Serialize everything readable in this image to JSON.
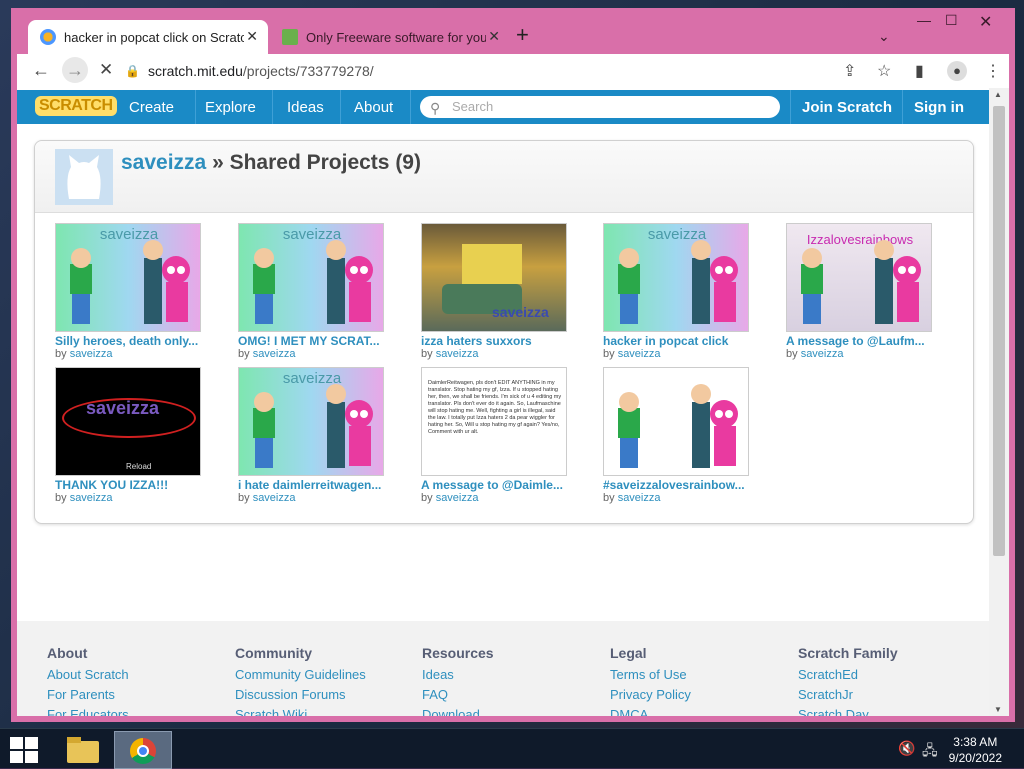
{
  "browser": {
    "tabs": [
      {
        "title": "hacker in popcat click on Scratch",
        "active": true
      },
      {
        "title": "Only Freeware software for your",
        "active": false
      }
    ],
    "new_tab": "+",
    "url_host": "scratch.mit.edu",
    "url_path": "/projects/733779278/"
  },
  "scratch_nav": {
    "logo": "SCRATCH",
    "links": [
      "Create",
      "Explore",
      "Ideas",
      "About"
    ],
    "search_placeholder": "Search",
    "join": "Join Scratch",
    "signin": "Sign in"
  },
  "profile": {
    "username": "saveizza",
    "heading_rest": " » Shared Projects (9)"
  },
  "projects": [
    {
      "title": "Silly heroes, death only...",
      "by": "by",
      "author": "saveizza",
      "thumb": "heroes"
    },
    {
      "title": "OMG! I MET MY SCRAT...",
      "by": "by",
      "author": "saveizza",
      "thumb": "heroes"
    },
    {
      "title": "izza haters suxxors",
      "by": "by",
      "author": "saveizza",
      "thumb": "game"
    },
    {
      "title": "hacker in popcat click",
      "by": "by",
      "author": "saveizza",
      "thumb": "heroes"
    },
    {
      "title": "A message to @Laufm...",
      "by": "by",
      "author": "saveizza",
      "thumb": "rainbows"
    },
    {
      "title": "THANK YOU IZZA!!!",
      "by": "by",
      "author": "saveizza",
      "thumb": "dark"
    },
    {
      "title": "i hate daimlerreitwagen...",
      "by": "by",
      "author": "saveizza",
      "thumb": "heroes"
    },
    {
      "title": "A message to @Daimle...",
      "by": "by",
      "author": "saveizza",
      "thumb": "text"
    },
    {
      "title": "#saveizzalovesrainbow...",
      "by": "by",
      "author": "saveizza",
      "thumb": "white"
    }
  ],
  "thumb_text": {
    "banner": "saveizza",
    "rainbows": "Izzalovesrainbows",
    "reload": "Reload",
    "message": "DaimlerReitwagen, pls don't EDIT ANYTHING in my translator. Stop hating my gf, Izza. If u stopped hating her, then, we shall be friends. I'm sick of u 4 editing my translator. Pls don't ever do it again. So, Laufmaschine will stop hating me. Well, fighting a girl is illegal, said the law. I totally put Izza haters 2 da pear wiggler for hating her. So, Will u stop hating my gf again? Yes/no, Comment with ur alt."
  },
  "footer": {
    "columns": [
      {
        "heading": "About",
        "links": [
          "About Scratch",
          "For Parents",
          "For Educators"
        ]
      },
      {
        "heading": "Community",
        "links": [
          "Community Guidelines",
          "Discussion Forums",
          "Scratch Wiki"
        ]
      },
      {
        "heading": "Resources",
        "links": [
          "Ideas",
          "FAQ",
          "Download"
        ]
      },
      {
        "heading": "Legal",
        "links": [
          "Terms of Use",
          "Privacy Policy",
          "DMCA"
        ]
      },
      {
        "heading": "Scratch Family",
        "links": [
          "ScratchEd",
          "ScratchJr",
          "Scratch Day"
        ]
      }
    ]
  },
  "taskbar": {
    "time": "3:38 AM",
    "date": "9/20/2022"
  },
  "colors": {
    "window_frame": "#d96fa9",
    "scratch_blue": "#1a8ac6",
    "link_blue": "#2e8fbe"
  }
}
